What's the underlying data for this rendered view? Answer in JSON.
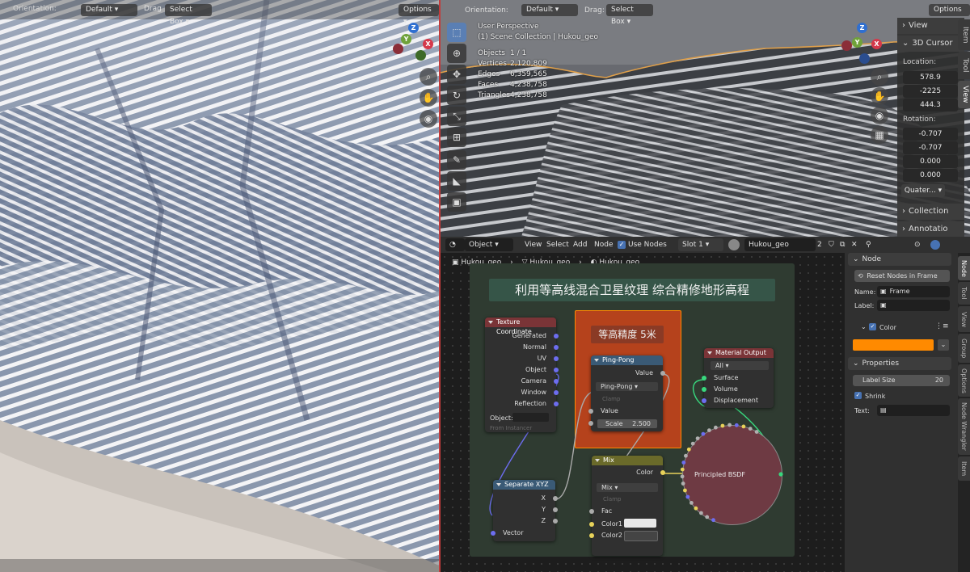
{
  "left_viewport": {
    "header": {
      "orientation_label": "Orientation:",
      "orientation_value": "Default",
      "drag_label": "Drag",
      "drag_value": "Select Box",
      "options_label": "Options"
    },
    "gizmo": {
      "x": "X",
      "y": "Y",
      "z": "Z"
    }
  },
  "right_viewport": {
    "header": {
      "orientation_label": "Orientation:",
      "orientation_value": "Default",
      "drag_label": "Drag:",
      "drag_value": "Select Box",
      "options_label": "Options"
    },
    "overlay": {
      "perspective": "User Perspective",
      "collection": "(1) Scene Collection | Hukou_geo"
    },
    "stats": [
      {
        "label": "Objects",
        "value": "1 / 1"
      },
      {
        "label": "Vertices",
        "value": "2,120,809"
      },
      {
        "label": "Edges",
        "value": "6,359,565"
      },
      {
        "label": "Faces",
        "value": "4,238,758"
      },
      {
        "label": "Triangles",
        "value": "4,238,758"
      }
    ],
    "gizmo": {
      "x": "X",
      "y": "Y",
      "z": "Z"
    },
    "n_panel": {
      "view_header": "View",
      "cursor_header": "3D Cursor",
      "location_label": "Location:",
      "location": [
        "578.9",
        "-2225",
        "444.3"
      ],
      "rotation_label": "Rotation:",
      "rotation": [
        "-0.707",
        "-0.707",
        "0.000",
        "0.000"
      ],
      "rotation_mode": "Quater...",
      "collection_header": "Collection",
      "annotation_header": "Annotatio"
    },
    "side_tabs": [
      "Item",
      "Tool",
      "View"
    ]
  },
  "node_editor": {
    "header": {
      "editor_type": "Object",
      "menus": [
        "View",
        "Select",
        "Add",
        "Node"
      ],
      "use_nodes_label": "Use Nodes",
      "slot": "Slot 1",
      "material_name": "Hukou_geo",
      "user_count": "2"
    },
    "breadcrumb": [
      "Hukou_geo",
      "Hukou_geo",
      "Hukou_geo"
    ],
    "frame_title": "利用等高线混合卫星纹理 综合精修地形高程",
    "inner_frame_label": "等高精度 5米",
    "nodes": {
      "texture_coordinate": {
        "title": "Texture Coordinate",
        "outputs": [
          "Generated",
          "Normal",
          "UV",
          "Object",
          "Camera",
          "Window",
          "Reflection"
        ],
        "object_label": "Object:",
        "from_instancer": "From Instancer"
      },
      "separate_xyz": {
        "title": "Separate XYZ",
        "outputs": [
          "X",
          "Y",
          "Z"
        ],
        "input": "Vector"
      },
      "ping_pong": {
        "title": "Ping-Pong",
        "output": "Value",
        "operation": "Ping-Pong",
        "clamp": "Clamp",
        "input": "Value",
        "scale_label": "Scale",
        "scale_value": "2.500"
      },
      "mix": {
        "title": "Mix",
        "output": "Color",
        "blend": "Mix",
        "clamp": "Clamp",
        "inputs": [
          "Fac",
          "Color1",
          "Color2"
        ],
        "color1": "#e8e8e8",
        "color2": "#444444"
      },
      "material_output": {
        "title": "Material Output",
        "target": "All",
        "inputs": [
          "Surface",
          "Volume",
          "Displacement"
        ]
      },
      "principled": {
        "title": "Principled BSDF"
      }
    },
    "side_panel": {
      "node_header": "Node",
      "reset_button": "Reset Nodes in Frame",
      "name_label": "Name:",
      "name_value": "Frame",
      "label_label": "Label:",
      "label_value": "",
      "color_label": "Color",
      "frame_color": "#ff8a00",
      "properties_header": "Properties",
      "label_size_label": "Label Size",
      "label_size_value": "20",
      "shrink_label": "Shrink",
      "text_label": "Text:"
    },
    "side_tabs": [
      "Node",
      "Tool",
      "View",
      "Group",
      "Options",
      "Node Wrangler",
      "Item"
    ]
  },
  "colors": {
    "accent_blue": "#4772b3",
    "frame_orange": "#ff8a00",
    "inner_frame_red": "#b5421c",
    "outer_frame_green": "#2f3b31",
    "title_frame_teal": "#365548"
  }
}
